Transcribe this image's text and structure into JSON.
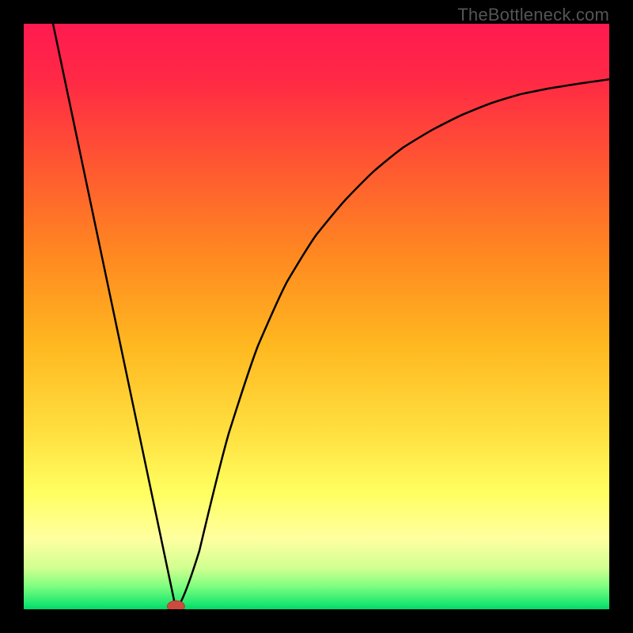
{
  "watermark": "TheBottleneck.com",
  "chart_data": {
    "type": "line",
    "title": "",
    "xlabel": "",
    "ylabel": "",
    "x_range": [
      0,
      100
    ],
    "y_range": [
      0,
      100
    ],
    "curve_points": [
      {
        "x": 5,
        "y": 100
      },
      {
        "x": 26,
        "y": 0
      },
      {
        "x": 30,
        "y": 10
      },
      {
        "x": 35,
        "y": 30
      },
      {
        "x": 40,
        "y": 45
      },
      {
        "x": 45,
        "y": 56
      },
      {
        "x": 50,
        "y": 64
      },
      {
        "x": 55,
        "y": 70
      },
      {
        "x": 60,
        "y": 75
      },
      {
        "x": 65,
        "y": 79
      },
      {
        "x": 70,
        "y": 82
      },
      {
        "x": 75,
        "y": 84.5
      },
      {
        "x": 80,
        "y": 86.5
      },
      {
        "x": 85,
        "y": 88
      },
      {
        "x": 90,
        "y": 89
      },
      {
        "x": 95,
        "y": 89.8
      },
      {
        "x": 100,
        "y": 90.5
      }
    ],
    "minimum_point": {
      "x": 26,
      "y": 0.5
    },
    "gradient_stops": [
      {
        "offset": 0,
        "color": "#ff1a50"
      },
      {
        "offset": 10,
        "color": "#ff2a44"
      },
      {
        "offset": 25,
        "color": "#ff5a30"
      },
      {
        "offset": 40,
        "color": "#ff8a20"
      },
      {
        "offset": 55,
        "color": "#ffb820"
      },
      {
        "offset": 70,
        "color": "#ffe040"
      },
      {
        "offset": 80,
        "color": "#ffff60"
      },
      {
        "offset": 88,
        "color": "#ffffa0"
      },
      {
        "offset": 93,
        "color": "#d0ff90"
      },
      {
        "offset": 96,
        "color": "#80ff80"
      },
      {
        "offset": 99,
        "color": "#20e870"
      },
      {
        "offset": 100,
        "color": "#00d868"
      }
    ]
  }
}
